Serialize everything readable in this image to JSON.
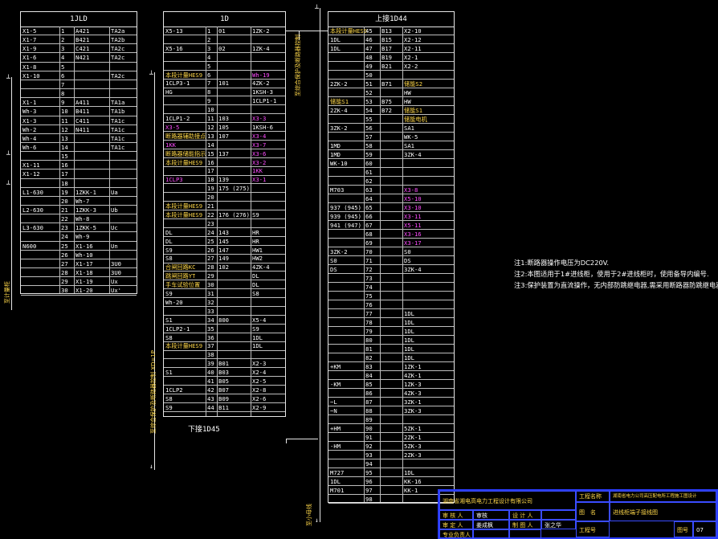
{
  "blocks": {
    "b1": {
      "title": "1JLD",
      "rows": [
        [
          "X1-5",
          "1",
          "A421",
          "TA2a"
        ],
        [
          "X1-7",
          "2",
          "B421",
          "TA2b"
        ],
        [
          "X1-9",
          "3",
          "C421",
          "TA2c"
        ],
        [
          "X1-6",
          "4",
          "N421",
          "TA2c"
        ],
        [
          "X1-8",
          "5",
          "",
          ""
        ],
        [
          "X1-10",
          "6",
          "",
          "TA2c"
        ],
        [
          "",
          "7",
          "",
          ""
        ],
        [
          "",
          "8",
          "",
          ""
        ],
        [
          "X1-1",
          "9",
          "A411",
          "TA1a"
        ],
        [
          "Wh-3",
          "10",
          "B411",
          "TA1b"
        ],
        [
          "X1-3",
          "11",
          "C411",
          "TA1c"
        ],
        [
          "Wh-2",
          "12",
          "N411",
          "TA1c"
        ],
        [
          "Wh-4",
          "13",
          "",
          "TA1c"
        ],
        [
          "Wh-6",
          "14",
          "",
          "TA1c"
        ],
        [
          "",
          "15",
          "",
          ""
        ],
        [
          "X1-11",
          "16",
          "",
          ""
        ],
        [
          "X1-12",
          "17",
          "",
          ""
        ],
        [
          "",
          "18",
          "",
          ""
        ],
        [
          "L1-630",
          "19",
          "1ZKK-1",
          "Ua"
        ],
        [
          "",
          "20",
          "Wh-7",
          ""
        ],
        [
          "L2-630",
          "21",
          "1ZKK-3",
          "Ub"
        ],
        [
          "",
          "22",
          "Wh-8",
          ""
        ],
        [
          "L3-630",
          "23",
          "1ZKK-5",
          "Uc"
        ],
        [
          "",
          "24",
          "Wh-9",
          ""
        ],
        [
          "N600",
          "25",
          "X1-16",
          "Un"
        ],
        [
          "",
          "26",
          "Wh-10",
          ""
        ],
        [
          "",
          "27",
          "X1-17",
          "3U0"
        ],
        [
          "",
          "28",
          "X1-18",
          "3U0"
        ],
        [
          "",
          "29",
          "X1-19",
          "Ux"
        ],
        [
          "",
          "30",
          "X1-20",
          "Ux'"
        ]
      ]
    },
    "b2": {
      "title": "1D",
      "footer": "下接1D45",
      "rows": [
        [
          "X5-13",
          "1",
          "01",
          "1ZK-2"
        ],
        [
          "",
          "2",
          "",
          ""
        ],
        [
          "X5-16",
          "3",
          "02",
          "1ZK-4"
        ],
        [
          "",
          "4",
          "",
          ""
        ],
        [
          "",
          "5",
          "",
          ""
        ],
        [
          "本段计量HES9",
          "6",
          "",
          "Wh-19"
        ],
        [
          "1CLP3-1",
          "7",
          "101",
          "4ZK-2"
        ],
        [
          "HG",
          "8",
          "",
          "1KSH-3"
        ],
        [
          "",
          "9",
          "",
          "1CLP1-1"
        ],
        [
          "",
          "10",
          "",
          ""
        ],
        [
          "1CLP1-2",
          "11",
          "103",
          "X3-3"
        ],
        [
          "X3-5",
          "12",
          "105",
          "1KSH-6"
        ],
        [
          "断路器辅助接点",
          "13",
          "107",
          "X3-4"
        ],
        [
          "1KK",
          "14",
          "",
          "X3-7"
        ],
        [
          "断路器储能指示",
          "15",
          "137",
          "X3-6"
        ],
        [
          "本段计量HES9",
          "16",
          "",
          "X3-2"
        ],
        [
          "",
          "17",
          "",
          "1KK"
        ],
        [
          "1CLP3",
          "18",
          "139",
          "X3-1"
        ],
        [
          "",
          "19",
          "175 (275)",
          ""
        ],
        [
          "",
          "20",
          "",
          ""
        ],
        [
          "本段计量HES9",
          "21",
          "",
          ""
        ],
        [
          "本段计量HES9",
          "22",
          "176 (276)",
          "S9"
        ],
        [
          "",
          "23",
          "",
          ""
        ],
        [
          "DL",
          "24",
          "143",
          "HR"
        ],
        [
          "DL",
          "25",
          "145",
          "HR"
        ],
        [
          "S9",
          "26",
          "147",
          "HW1"
        ],
        [
          "S8",
          "27",
          "149",
          "HW2"
        ],
        [
          "合闸回路KC",
          "28",
          "102",
          "4ZK-4"
        ],
        [
          "跳闸回路YT",
          "29",
          "",
          "DL"
        ],
        [
          "手车试验位置",
          "30",
          "",
          "DL"
        ],
        [
          "S9",
          "31",
          "",
          "S8"
        ],
        [
          "Wh-20",
          "32",
          "",
          ""
        ],
        [
          "",
          "33",
          "",
          ""
        ],
        [
          "S1",
          "34",
          "800",
          "X5-4"
        ],
        [
          "1CLP2-1",
          "35",
          "",
          "S9"
        ],
        [
          "S8",
          "36",
          "",
          "1DL"
        ],
        [
          "本段计量HES9",
          "37",
          "",
          "1DL"
        ],
        [
          "",
          "38",
          "",
          ""
        ],
        [
          "",
          "39",
          "B01",
          "X2-3"
        ],
        [
          "S1",
          "40",
          "B03",
          "X2-4"
        ],
        [
          "",
          "41",
          "B05",
          "X2-5"
        ],
        [
          "1CLP2",
          "42",
          "B07",
          "X2-8"
        ],
        [
          "S8",
          "43",
          "B09",
          "X2-6"
        ],
        [
          "S9",
          "44",
          "B11",
          "X2-9"
        ]
      ]
    },
    "b3": {
      "title": "上接1D44",
      "rows": [
        [
          "本段计量HES9",
          "45",
          "B13",
          "X2-10"
        ],
        [
          "1DL",
          "46",
          "B15",
          "X2-12"
        ],
        [
          "1DL",
          "47",
          "B17",
          "X2-11"
        ],
        [
          "",
          "48",
          "B19",
          "X2-1"
        ],
        [
          "",
          "49",
          "B21",
          "X2-2"
        ],
        [
          "",
          "50",
          "",
          ""
        ],
        [
          "2ZK-2",
          "51",
          "B71",
          "储能S2"
        ],
        [
          "",
          "52",
          "",
          "HW"
        ],
        [
          "储能S1",
          "53",
          "B75",
          "HW"
        ],
        [
          "2ZK-4",
          "54",
          "B72",
          "储能S1"
        ],
        [
          "",
          "55",
          "",
          "储能电机"
        ],
        [
          "3ZK-2",
          "56",
          "",
          "SA1"
        ],
        [
          "",
          "57",
          "",
          "WK-5"
        ],
        [
          "1MD",
          "58",
          "",
          "SA1"
        ],
        [
          "1MD",
          "59",
          "",
          "3ZK-4"
        ],
        [
          "WK-10",
          "60",
          "",
          ""
        ],
        [
          "",
          "61",
          "",
          ""
        ],
        [
          "",
          "62",
          "",
          ""
        ],
        [
          "M703",
          "63",
          "",
          "X3-8"
        ],
        [
          "",
          "64",
          "",
          "X5-10"
        ],
        [
          "937 (945)",
          "65",
          "",
          "X3-10"
        ],
        [
          "939 (945)",
          "66",
          "",
          "X3-11"
        ],
        [
          "941 (947)",
          "67",
          "",
          "X5-11"
        ],
        [
          "",
          "68",
          "",
          "X3-16"
        ],
        [
          "",
          "69",
          "",
          "X3-17"
        ],
        [
          "3ZK-2",
          "70",
          "",
          "S0"
        ],
        [
          "S0",
          "71",
          "",
          "DS"
        ],
        [
          "DS",
          "72",
          "",
          "3ZK-4"
        ],
        [
          "",
          "73",
          "",
          ""
        ],
        [
          "",
          "74",
          "",
          ""
        ],
        [
          "",
          "75",
          "",
          ""
        ],
        [
          "",
          "76",
          "",
          ""
        ],
        [
          "",
          "77",
          "",
          "1DL"
        ],
        [
          "",
          "78",
          "",
          "1DL"
        ],
        [
          "",
          "79",
          "",
          "1DL"
        ],
        [
          "",
          "80",
          "",
          "1DL"
        ],
        [
          "",
          "81",
          "",
          "1DL"
        ],
        [
          "",
          "82",
          "",
          "1DL"
        ],
        [
          "+KM",
          "83",
          "",
          "1ZK-1"
        ],
        [
          "",
          "84",
          "",
          "4ZK-1"
        ],
        [
          "-KM",
          "85",
          "",
          "1ZK-3"
        ],
        [
          "",
          "86",
          "",
          "4ZK-3"
        ],
        [
          "~L",
          "87",
          "",
          "3ZK-1"
        ],
        [
          "~N",
          "88",
          "",
          "3ZK-3"
        ],
        [
          "",
          "89",
          "",
          ""
        ],
        [
          "+HM",
          "90",
          "",
          "5ZK-1"
        ],
        [
          "",
          "91",
          "",
          "2ZK-1"
        ],
        [
          "-HM",
          "92",
          "",
          "5ZK-3"
        ],
        [
          "",
          "93",
          "",
          "2ZK-3"
        ],
        [
          "",
          "94",
          "",
          ""
        ],
        [
          "M727",
          "95",
          "",
          "1DL"
        ],
        [
          "1DL",
          "96",
          "",
          "KK-16"
        ],
        [
          "M701",
          "97",
          "",
          "KK-1"
        ],
        [
          "",
          "98",
          "",
          ""
        ]
      ]
    }
  },
  "notes": [
    "注1:断路器操作电压为DC220V.",
    "注2:本图适用于1#进线柜，使用于2#进线柜时，使用备导内编号.",
    "注3:保护装置为直流操作，无内部防跳继电器,需采用断路器防跳继电器."
  ],
  "vertical_labels": {
    "left": "至计量柜",
    "mid": "至综合保护及断路器控制 XD=1P",
    "right": "至综合保护及断路器控制",
    "right2": "至小母线"
  },
  "titleblock": {
    "company": "湖南省湘电高电力工程设计有限公司",
    "project_label": "工程名称",
    "project_text": "湖南省电力公司高压配电所工程施工图设计",
    "drawing_label": "图　名",
    "drawing_text": "进线柜端子接线图",
    "row1": [
      "审 核 人",
      "审核",
      "设 计 人",
      ""
    ],
    "row2": [
      "审 定 人",
      "姜成枫",
      "制 图 人",
      "张之华"
    ],
    "row3": [
      "专业负责人",
      "",
      "",
      "工程号"
    ],
    "sheet_label": "图号",
    "sheet_no": "07"
  }
}
